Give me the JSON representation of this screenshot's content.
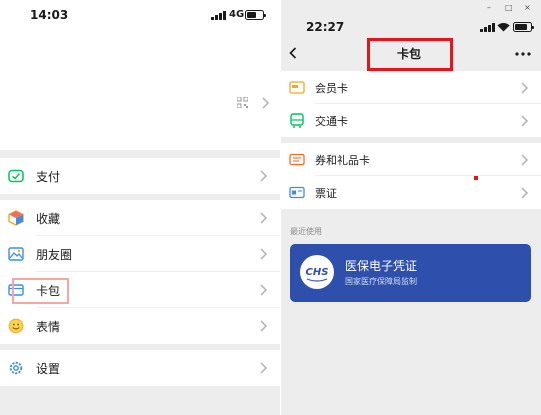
{
  "left_phone": {
    "status_bar": {
      "time": "14:03",
      "network": "4G"
    },
    "menu": [
      {
        "label": "支付",
        "icon": "payment-icon"
      },
      {
        "label": "收藏",
        "icon": "favorites-icon"
      },
      {
        "label": "朋友圈",
        "icon": "moments-icon"
      },
      {
        "label": "卡包",
        "icon": "card-wallet-icon"
      },
      {
        "label": "表情",
        "icon": "stickers-icon"
      },
      {
        "label": "设置",
        "icon": "settings-icon"
      }
    ]
  },
  "right_phone": {
    "status_bar": {
      "time": "22:27"
    },
    "window_controls": [
      "–",
      "□",
      "×"
    ],
    "nav": {
      "title": "卡包"
    },
    "group1": [
      {
        "label": "会员卡",
        "icon": "membership-card-icon"
      },
      {
        "label": "交通卡",
        "icon": "transit-card-icon"
      }
    ],
    "group2": [
      {
        "label": "券和礼品卡",
        "icon": "coupon-icon"
      },
      {
        "label": "票证",
        "icon": "ticket-icon"
      }
    ],
    "recent_label": "最近使用",
    "recent_card": {
      "logo_text": "CHS",
      "title": "医保电子凭证",
      "subtitle": "国家医疗保障局监制",
      "color": "#2f4fad"
    }
  },
  "colors": {
    "highlight_red": "#e8141b",
    "highlight_pink": "#f4a7a2",
    "wechat_green": "#07c160"
  }
}
